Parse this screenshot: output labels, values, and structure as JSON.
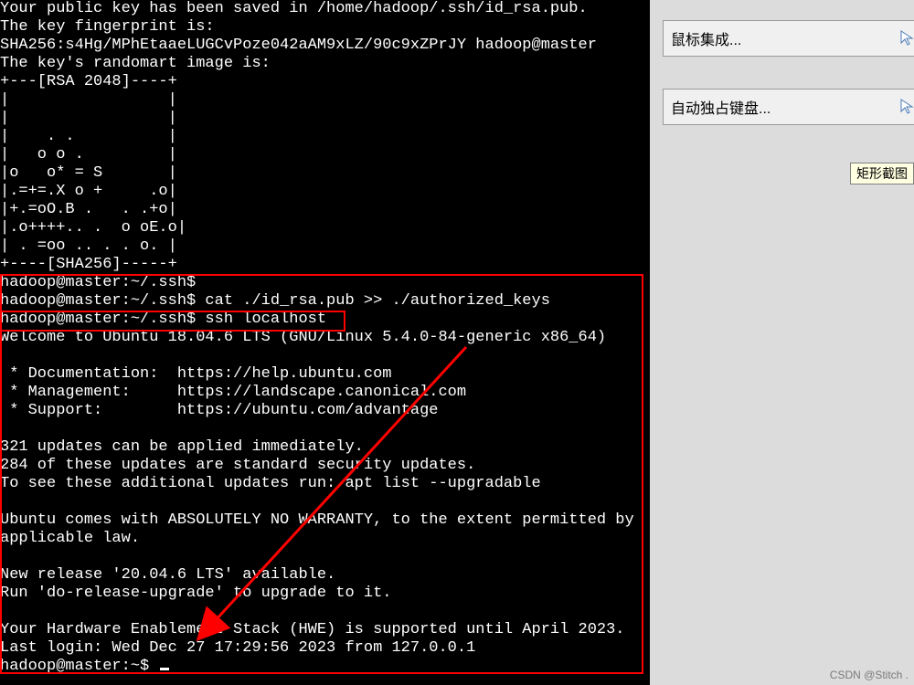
{
  "terminal": {
    "lines": [
      "Your public key has been saved in /home/hadoop/.ssh/id_rsa.pub.",
      "The key fingerprint is:",
      "SHA256:s4Hg/MPhEtaaeLUGCvPoze042aAM9xLZ/90c9xZPrJY hadoop@master",
      "The key's randomart image is:",
      "+---[RSA 2048]----+",
      "|                 |",
      "|                 |",
      "|    . .          |",
      "|   o o .         |",
      "|o   o* = S       |",
      "|.=+=.X o +     .o|",
      "|+.=oO.B .   . .+o|",
      "|.o++++.. .  o oE.o|",
      "| . =oo .. . . o. |",
      "+----[SHA256]-----+",
      "hadoop@master:~/.ssh$",
      "hadoop@master:~/.ssh$ cat ./id_rsa.pub >> ./authorized_keys",
      "hadoop@master:~/.ssh$ ssh localhost",
      "Welcome to Ubuntu 18.04.6 LTS (GNU/Linux 5.4.0-84-generic x86_64)",
      "",
      " * Documentation:  https://help.ubuntu.com",
      " * Management:     https://landscape.canonical.com",
      " * Support:        https://ubuntu.com/advantage",
      "",
      "321 updates can be applied immediately.",
      "284 of these updates are standard security updates.",
      "To see these additional updates run: apt list --upgradable",
      "",
      "Ubuntu comes with ABSOLUTELY NO WARRANTY, to the extent permitted by",
      "applicable law.",
      "",
      "New release '20.04.6 LTS' available.",
      "Run 'do-release-upgrade' to upgrade to it.",
      "",
      "Your Hardware Enablement Stack (HWE) is supported until April 2023.",
      "Last login: Wed Dec 27 17:29:56 2023 from 127.0.0.1"
    ],
    "prompt_end": "hadoop@master:~$ "
  },
  "sidebar": {
    "button1": "鼠标集成...",
    "button2": "自动独占键盘...",
    "tooltip": "矩形截图"
  },
  "watermark": "CSDN @Stitch ."
}
